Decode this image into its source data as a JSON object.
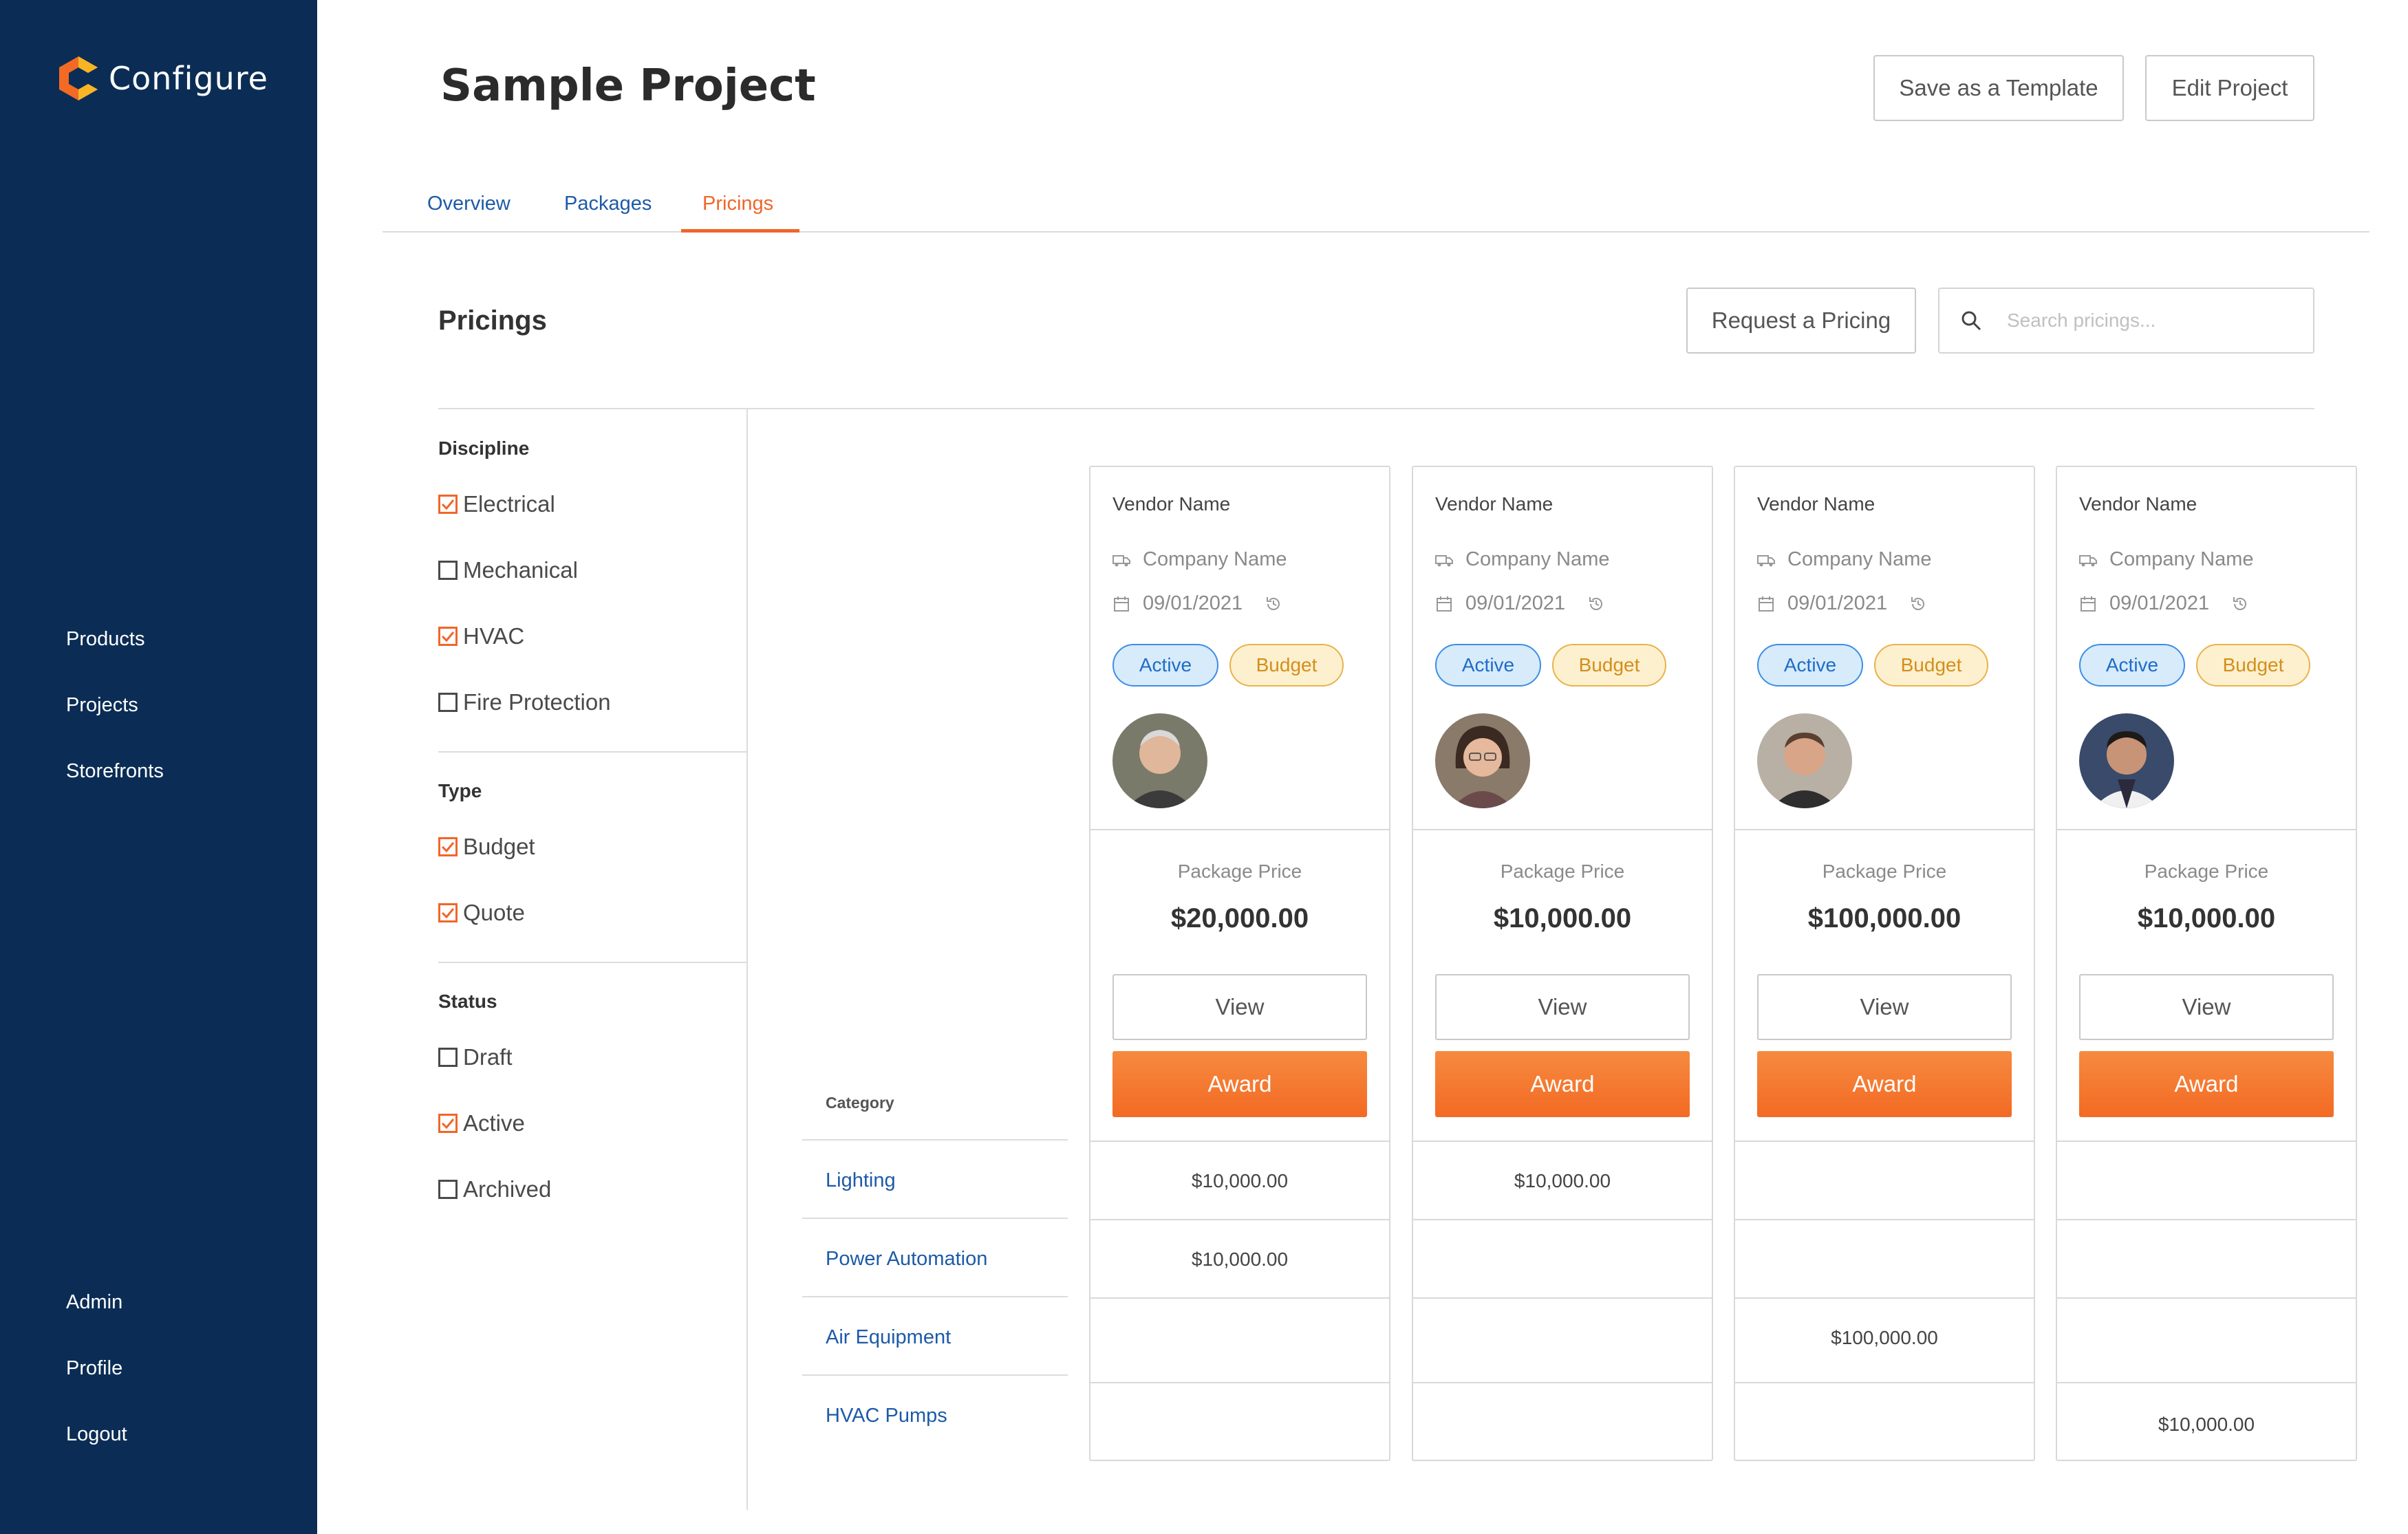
{
  "app": {
    "logo_text": "Configure",
    "brand_colors": {
      "navy": "#0b2d55",
      "orange": "#f0662a",
      "yellow": "#f7b526"
    }
  },
  "sidebar": {
    "items": [
      {
        "label": "Products"
      },
      {
        "label": "Projects"
      },
      {
        "label": "Storefronts"
      }
    ],
    "bottom_items": [
      {
        "label": "Admin"
      },
      {
        "label": "Profile"
      },
      {
        "label": "Logout"
      }
    ]
  },
  "header": {
    "title": "Sample Project",
    "save_template_label": "Save as a Template",
    "edit_project_label": "Edit Project"
  },
  "tabs": [
    {
      "label": "Overview",
      "active": false
    },
    {
      "label": "Packages",
      "active": false
    },
    {
      "label": "Pricings",
      "active": true
    }
  ],
  "pricings": {
    "title": "Pricings",
    "request_label": "Request a Pricing",
    "search_placeholder": "Search pricings..."
  },
  "filters": {
    "discipline": {
      "title": "Discipline",
      "options": [
        {
          "label": "Electrical",
          "checked": true
        },
        {
          "label": "Mechanical",
          "checked": false
        },
        {
          "label": "HVAC",
          "checked": true
        },
        {
          "label": "Fire Protection",
          "checked": false
        }
      ]
    },
    "type": {
      "title": "Type",
      "options": [
        {
          "label": "Budget",
          "checked": true
        },
        {
          "label": "Quote",
          "checked": true
        }
      ]
    },
    "status": {
      "title": "Status",
      "options": [
        {
          "label": "Draft",
          "checked": false
        },
        {
          "label": "Active",
          "checked": true
        },
        {
          "label": "Archived",
          "checked": false
        }
      ]
    }
  },
  "categories": {
    "header": "Category",
    "items": [
      "Lighting",
      "Power Automation",
      "Air Equipment",
      "HVAC Pumps"
    ]
  },
  "vendors": [
    {
      "vendor_name": "Vendor Name",
      "company": "Company Name",
      "date": "09/01/2021",
      "status": "Active",
      "type": "Budget",
      "avatar": "avatar-older-man",
      "price_label": "Package Price",
      "price": "$20,000.00",
      "view_label": "View",
      "award_label": "Award",
      "cells": [
        "$10,000.00",
        "$10,000.00",
        "",
        ""
      ]
    },
    {
      "vendor_name": "Vendor Name",
      "company": "Company Name",
      "date": "09/01/2021",
      "status": "Active",
      "type": "Budget",
      "avatar": "avatar-woman-glasses",
      "price_label": "Package Price",
      "price": "$10,000.00",
      "view_label": "View",
      "award_label": "Award",
      "cells": [
        "$10,000.00",
        "",
        "",
        ""
      ]
    },
    {
      "vendor_name": "Vendor Name",
      "company": "Company Name",
      "date": "09/01/2021",
      "status": "Active",
      "type": "Budget",
      "avatar": "avatar-man",
      "price_label": "Package Price",
      "price": "$100,000.00",
      "view_label": "View",
      "award_label": "Award",
      "cells": [
        "",
        "",
        "$100,000.00",
        ""
      ]
    },
    {
      "vendor_name": "Vendor Name",
      "company": "Company Name",
      "date": "09/01/2021",
      "status": "Active",
      "type": "Budget",
      "avatar": "avatar-young-man",
      "price_label": "Package Price",
      "price": "$10,000.00",
      "view_label": "View",
      "award_label": "Award",
      "cells": [
        "",
        "",
        "",
        "$10,000.00"
      ]
    }
  ]
}
